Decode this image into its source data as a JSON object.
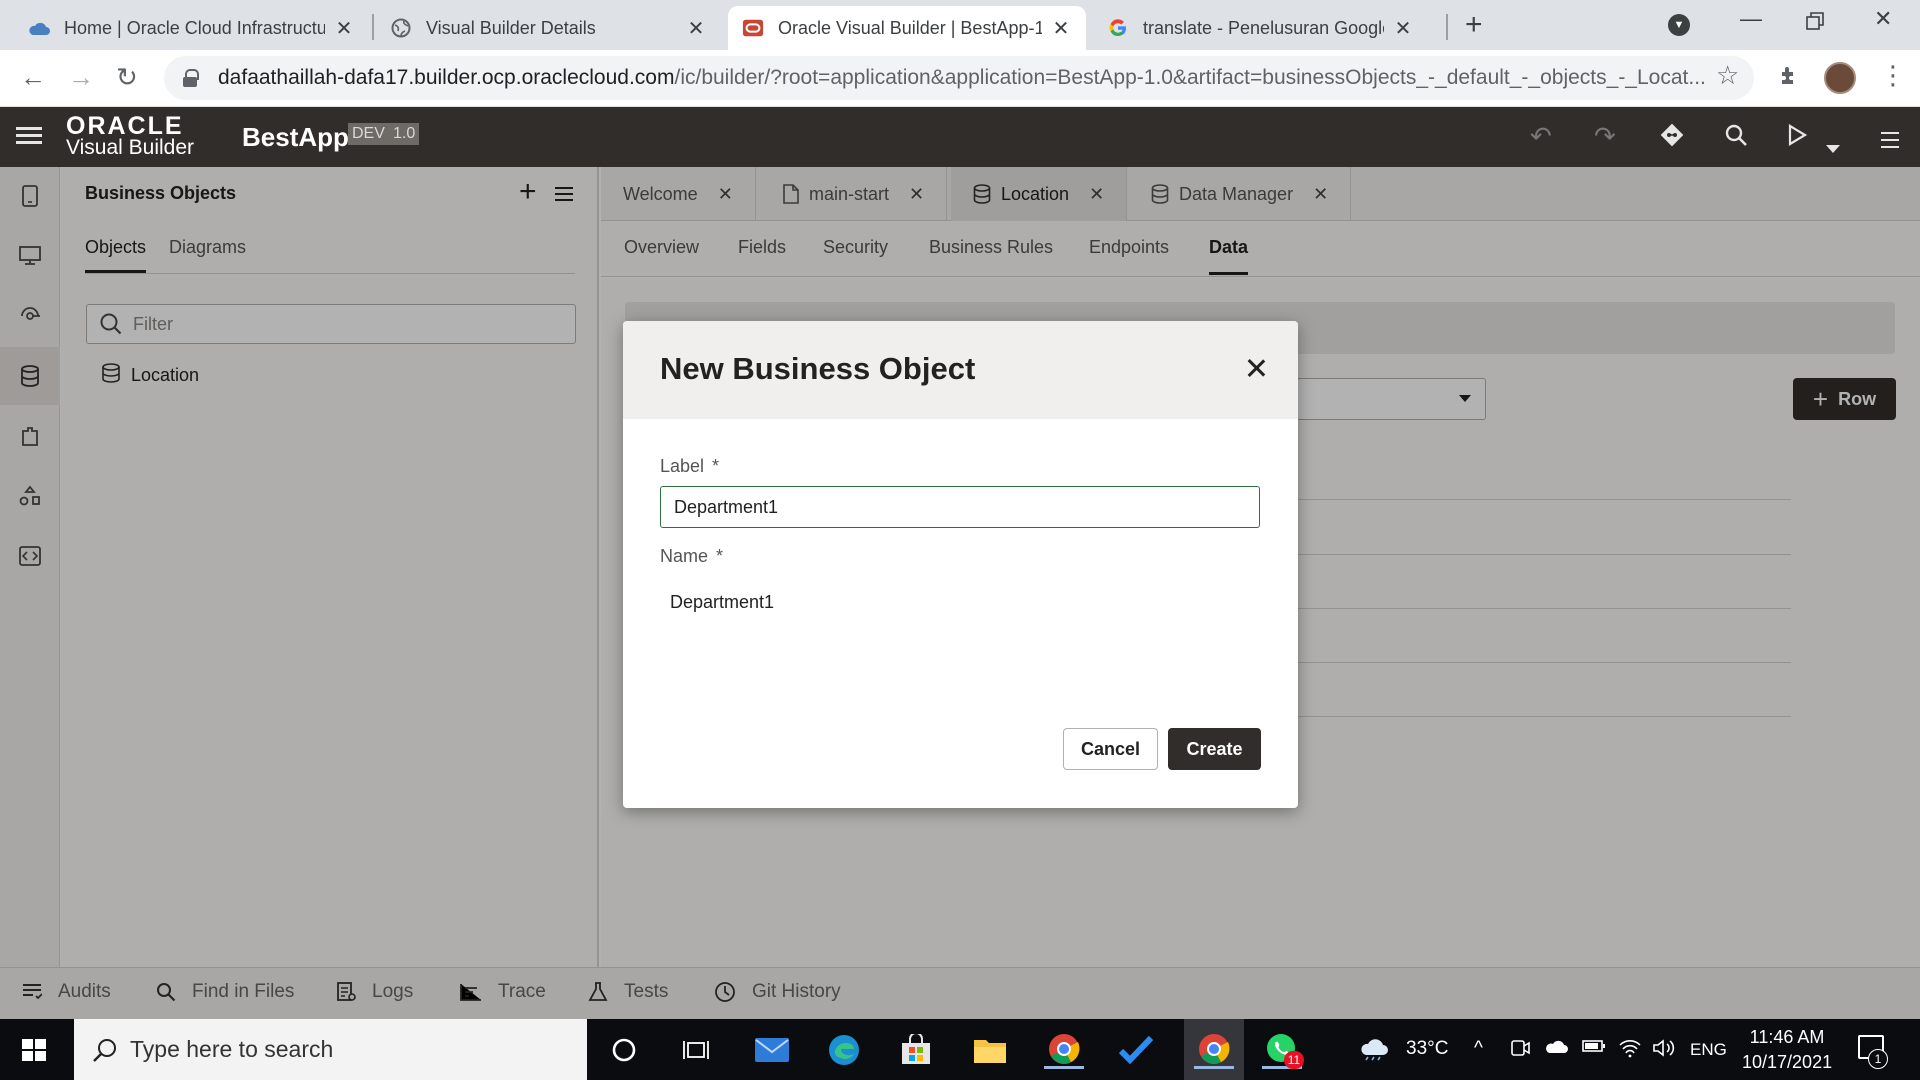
{
  "browser": {
    "tabs": [
      {
        "title": "Home | Oracle Cloud Infrastructu",
        "favicon": "oracle-cloud-icon"
      },
      {
        "title": "Visual Builder Details",
        "favicon": "globe-icon"
      },
      {
        "title": "Oracle Visual Builder | BestApp-1",
        "favicon": "oracle-icon",
        "active": true
      },
      {
        "title": "translate - Penelusuran Google",
        "favicon": "google-icon"
      }
    ],
    "url_host": "dafaathaillah-dafa17.builder.ocp.oraclecloud.com",
    "url_path": "/ic/builder/?root=application&application=BestApp-1.0&artifact=businessObjects_-_default_-_objects_-_Locat..."
  },
  "vb_header": {
    "logo_top": "ORACLE",
    "logo_bottom": "Visual Builder",
    "app_name": "BestApp",
    "env_badge": "DEV",
    "version_badge": "1.0"
  },
  "bo_panel": {
    "title": "Business Objects",
    "tabs": [
      "Objects",
      "Diagrams"
    ],
    "filter_placeholder": "Filter",
    "items": [
      "Location"
    ]
  },
  "editor_tabs": [
    "Welcome",
    "main-start",
    "Location",
    "Data Manager"
  ],
  "object_tabs": [
    "Overview",
    "Fields",
    "Security",
    "Business Rules",
    "Endpoints",
    "Data"
  ],
  "data_page": {
    "row_button": "Row"
  },
  "bottom_bar": [
    "Audits",
    "Find in Files",
    "Logs",
    "Trace",
    "Tests",
    "Git History"
  ],
  "dialog": {
    "title": "New Business Object",
    "label_caption": "Label",
    "label_value": "Department1",
    "name_caption": "Name",
    "name_value": "Department1",
    "required_mark": "*",
    "cancel": "Cancel",
    "create": "Create"
  },
  "taskbar": {
    "search_placeholder": "Type here to search",
    "weather": "33°C",
    "language": "ENG",
    "time": "11:46 AM",
    "date": "10/17/2021",
    "notification_count": "1",
    "whatsapp_badge": "11"
  },
  "colors": {
    "vb_header": "#312d2a",
    "primary_button": "#312d2a",
    "input_focus_border": "#2f6f3e",
    "oracle_red": "#c74634"
  }
}
